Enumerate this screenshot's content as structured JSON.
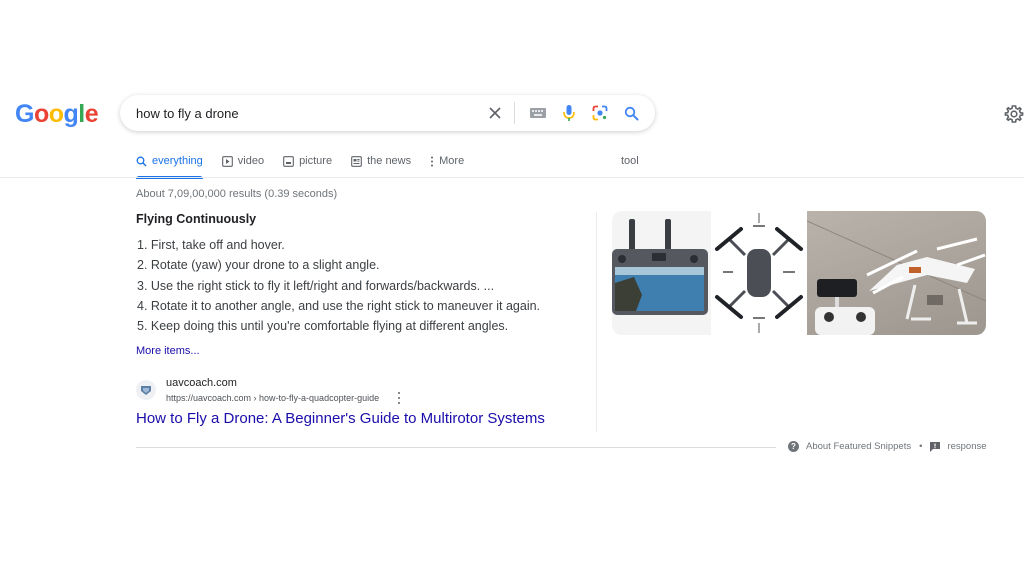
{
  "logo": {
    "letters": [
      "G",
      "o",
      "o",
      "g",
      "l",
      "e"
    ],
    "colors": [
      "#4285F4",
      "#EA4335",
      "#FBBC05",
      "#4285F4",
      "#34A853",
      "#EA4335"
    ]
  },
  "search": {
    "query": "how to fly a drone",
    "icons": [
      "clear-icon",
      "keyboard-icon",
      "microphone-icon",
      "lens-icon",
      "search-icon"
    ]
  },
  "settings": {
    "icon": "gear-icon"
  },
  "tabs": [
    {
      "label": "everything",
      "icon": "search-icon",
      "active": true
    },
    {
      "label": "video",
      "icon": "play-icon",
      "active": false
    },
    {
      "label": "picture",
      "icon": "image-icon",
      "active": false
    },
    {
      "label": "the news",
      "icon": "newspaper-icon",
      "active": false
    },
    {
      "label": "More",
      "icon": "more-vert-icon",
      "active": false
    }
  ],
  "tools_label": "tool",
  "result_stats": "About 7,09,00,000 results (0.39 seconds)",
  "featured_snippet": {
    "title": "Flying Continuously",
    "steps": [
      "1. First, take off and hover.",
      "2. Rotate (yaw) your drone to a slight angle.",
      "3. Use the right stick to fly it left/right and forwards/backwards. ...",
      "4. Rotate it to another angle, and use the right stick to maneuver it again.",
      "5. Keep doing this until you're comfortable flying at different angles."
    ],
    "more_items": "More items...",
    "source": {
      "site_name": "uavcoach.com",
      "url": "https://uavcoach.com › how-to-fly-a-quadcopter-guide",
      "title": "How to Fly a Drone: A Beginner's Guide to Multirotor Systems"
    },
    "images": [
      {
        "alt": "Drone smart controller with screen"
      },
      {
        "alt": "Drone control diagram: Pitch (forward), Roll (left), Roll (right), Pitch (backward)"
      },
      {
        "alt": "White quadcopter drone with remote controller on pavement"
      }
    ]
  },
  "footer": {
    "about_label": "About Featured Snippets",
    "separator": "•",
    "feedback_label": "response"
  },
  "colors": {
    "accent": "#1a73e8",
    "link": "#1a0dab",
    "secondary_text": "#70757a"
  }
}
